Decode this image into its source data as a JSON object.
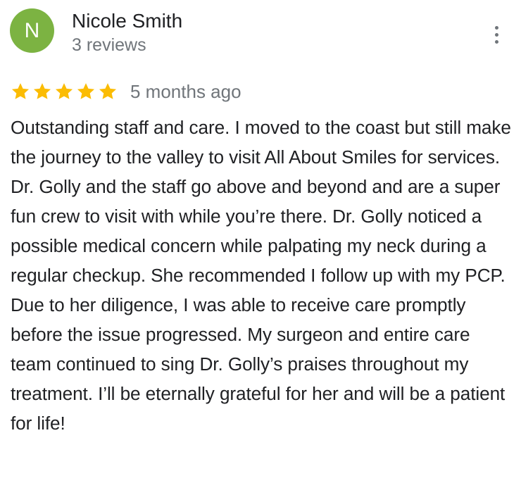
{
  "reviewer": {
    "avatar_letter": "N",
    "avatar_color": "#7cb342",
    "name": "Nicole Smith",
    "review_count": "3 reviews"
  },
  "menu": {
    "icon": "more-vert-icon"
  },
  "review": {
    "rating": 5,
    "max_rating": 5,
    "star_color": "#fbbc04",
    "date": "5 months ago",
    "text": "Outstanding staff and care. I moved to the coast but still make the journey to the valley to visit All About Smiles for services. Dr. Golly and the staff go above and beyond and are a super fun crew to visit with while you’re there. Dr. Golly noticed a possible medical concern while palpating my neck during a regular checkup. She recommended I follow up with my PCP. Due to her diligence, I was able to receive care promptly before the issue progressed. My surgeon and entire care team continued to sing Dr. Golly’s praises throughout my treatment. I’ll be eternally grateful for her and will be a patient for life!"
  }
}
